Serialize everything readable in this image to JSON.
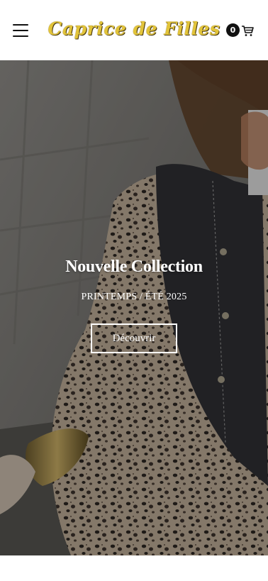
{
  "header": {
    "menu_icon": "hamburger-menu-icon",
    "logo_text": "Caprice de Filles",
    "logo_color": "#e2c43a",
    "cart_count": "0",
    "cart_icon": "shopping-cart-icon"
  },
  "hero": {
    "title": "Nouvelle Collection",
    "subtitle": "PRINTEMPS / ÉTÉ 2025",
    "button_label": "Découvrir"
  }
}
